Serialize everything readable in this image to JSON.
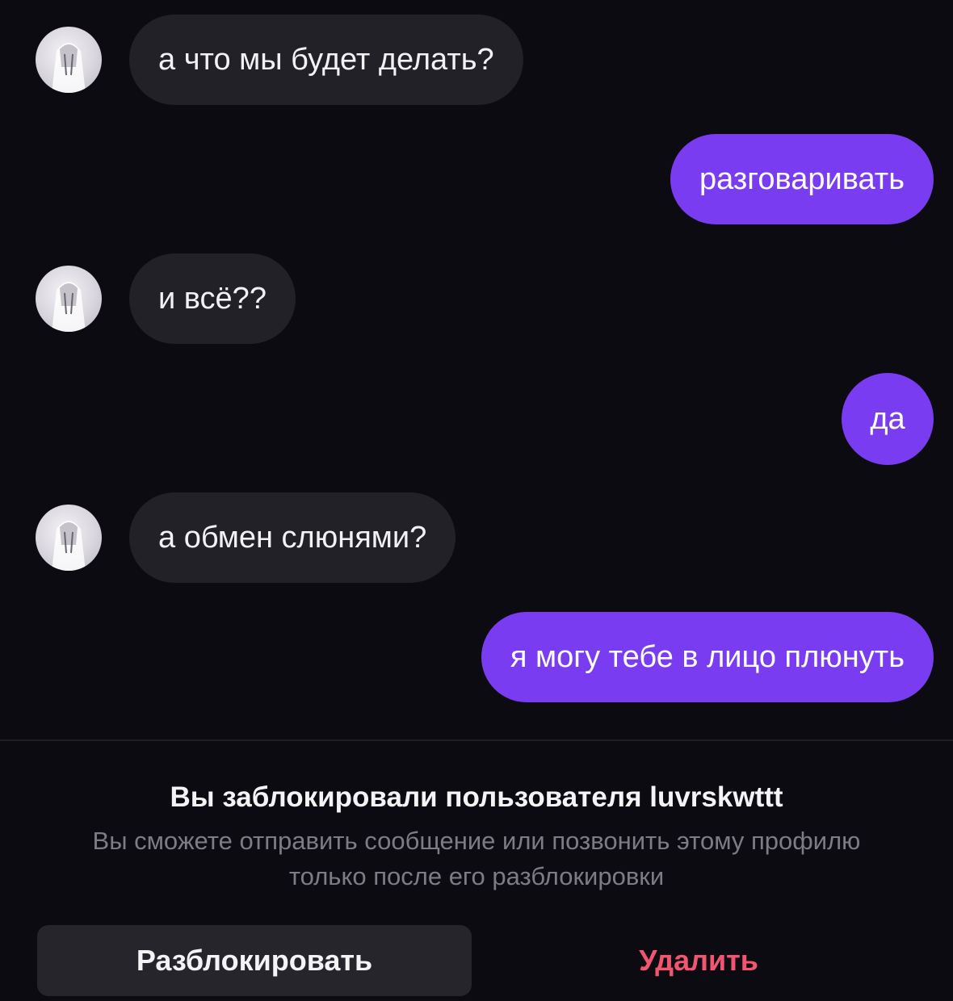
{
  "messages": [
    {
      "direction": "incoming",
      "text": "а что мы будет делать?"
    },
    {
      "direction": "outgoing",
      "text": "разговаривать"
    },
    {
      "direction": "incoming",
      "text": "и всё??"
    },
    {
      "direction": "outgoing",
      "text": "да"
    },
    {
      "direction": "incoming",
      "text": "а обмен слюнями?"
    },
    {
      "direction": "outgoing",
      "text": "я могу тебе в лицо плюнуть"
    }
  ],
  "blocked": {
    "title": "Вы заблокировали пользователя luvrskwttt",
    "description": "Вы сможете отправить сообщение или позвонить этому профилю только после его разблокировки",
    "unblock_label": "Разблокировать",
    "delete_label": "Удалить"
  },
  "colors": {
    "background": "#0c0b11",
    "incoming_bubble": "#222127",
    "outgoing_bubble": "#7a3cf0",
    "delete_text": "#f2556f"
  },
  "icons": {
    "avatar": "user-avatar-icon"
  }
}
